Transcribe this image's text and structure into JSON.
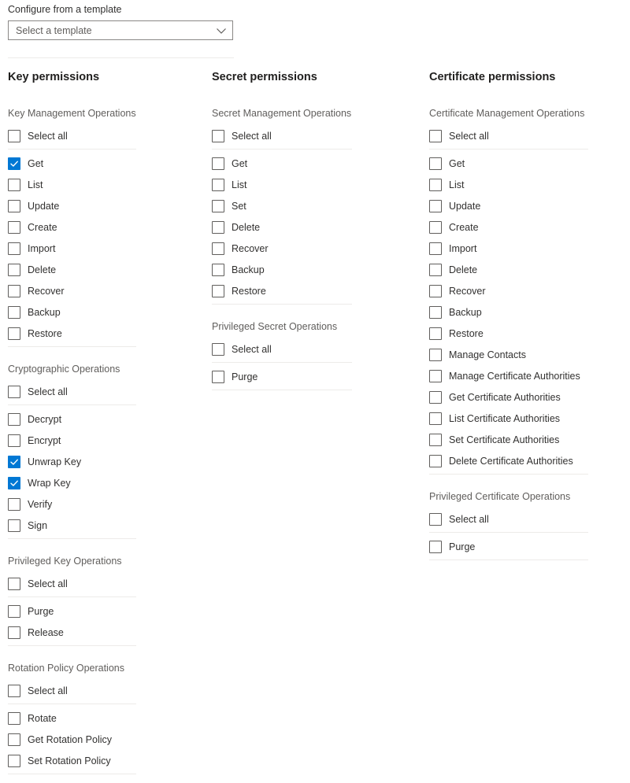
{
  "template": {
    "label": "Configure from a template",
    "placeholder": "Select a template",
    "value": "Select a template",
    "chevron_icon": "chevron-down-icon"
  },
  "colors": {
    "accent": "#0078d4",
    "text": "#323130",
    "muted": "#605e5c",
    "divider": "#edebe9",
    "border": "#8a8886"
  },
  "columns": [
    {
      "key": "key",
      "title": "Key permissions",
      "groups": [
        {
          "title": "Key Management Operations",
          "select_all": {
            "label": "Select all",
            "checked": false
          },
          "items": [
            {
              "label": "Get",
              "checked": true
            },
            {
              "label": "List",
              "checked": false
            },
            {
              "label": "Update",
              "checked": false
            },
            {
              "label": "Create",
              "checked": false
            },
            {
              "label": "Import",
              "checked": false
            },
            {
              "label": "Delete",
              "checked": false
            },
            {
              "label": "Recover",
              "checked": false
            },
            {
              "label": "Backup",
              "checked": false
            },
            {
              "label": "Restore",
              "checked": false
            }
          ]
        },
        {
          "title": "Cryptographic Operations",
          "select_all": {
            "label": "Select all",
            "checked": false
          },
          "items": [
            {
              "label": "Decrypt",
              "checked": false
            },
            {
              "label": "Encrypt",
              "checked": false
            },
            {
              "label": "Unwrap Key",
              "checked": true
            },
            {
              "label": "Wrap Key",
              "checked": true
            },
            {
              "label": "Verify",
              "checked": false
            },
            {
              "label": "Sign",
              "checked": false
            }
          ]
        },
        {
          "title": "Privileged Key Operations",
          "select_all": {
            "label": "Select all",
            "checked": false
          },
          "items": [
            {
              "label": "Purge",
              "checked": false
            },
            {
              "label": "Release",
              "checked": false
            }
          ]
        },
        {
          "title": "Rotation Policy Operations",
          "select_all": {
            "label": "Select all",
            "checked": false
          },
          "items": [
            {
              "label": "Rotate",
              "checked": false
            },
            {
              "label": "Get Rotation Policy",
              "checked": false
            },
            {
              "label": "Set Rotation Policy",
              "checked": false
            }
          ]
        }
      ]
    },
    {
      "key": "secret",
      "title": "Secret permissions",
      "groups": [
        {
          "title": "Secret Management Operations",
          "select_all": {
            "label": "Select all",
            "checked": false
          },
          "items": [
            {
              "label": "Get",
              "checked": false
            },
            {
              "label": "List",
              "checked": false
            },
            {
              "label": "Set",
              "checked": false
            },
            {
              "label": "Delete",
              "checked": false
            },
            {
              "label": "Recover",
              "checked": false
            },
            {
              "label": "Backup",
              "checked": false
            },
            {
              "label": "Restore",
              "checked": false
            }
          ]
        },
        {
          "title": "Privileged Secret Operations",
          "select_all": {
            "label": "Select all",
            "checked": false
          },
          "items": [
            {
              "label": "Purge",
              "checked": false
            }
          ]
        }
      ]
    },
    {
      "key": "certificate",
      "title": "Certificate permissions",
      "groups": [
        {
          "title": "Certificate Management Operations",
          "select_all": {
            "label": "Select all",
            "checked": false
          },
          "items": [
            {
              "label": "Get",
              "checked": false
            },
            {
              "label": "List",
              "checked": false
            },
            {
              "label": "Update",
              "checked": false
            },
            {
              "label": "Create",
              "checked": false
            },
            {
              "label": "Import",
              "checked": false
            },
            {
              "label": "Delete",
              "checked": false
            },
            {
              "label": "Recover",
              "checked": false
            },
            {
              "label": "Backup",
              "checked": false
            },
            {
              "label": "Restore",
              "checked": false
            },
            {
              "label": "Manage Contacts",
              "checked": false
            },
            {
              "label": "Manage Certificate Authorities",
              "checked": false
            },
            {
              "label": "Get Certificate Authorities",
              "checked": false
            },
            {
              "label": "List Certificate Authorities",
              "checked": false
            },
            {
              "label": "Set Certificate Authorities",
              "checked": false
            },
            {
              "label": "Delete Certificate Authorities",
              "checked": false
            }
          ]
        },
        {
          "title": "Privileged Certificate Operations",
          "select_all": {
            "label": "Select all",
            "checked": false
          },
          "items": [
            {
              "label": "Purge",
              "checked": false
            }
          ]
        }
      ]
    }
  ]
}
